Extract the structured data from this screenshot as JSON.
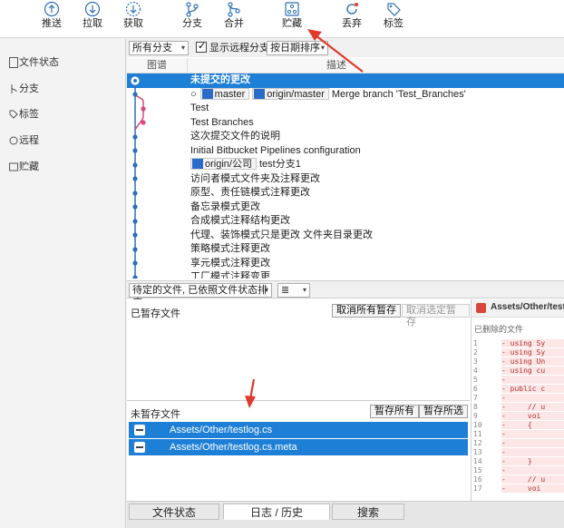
{
  "toolbar": {
    "buttons": [
      {
        "label": "推送",
        "icon": "push-icon"
      },
      {
        "label": "拉取",
        "icon": "pull-icon"
      },
      {
        "label": "获取",
        "icon": "fetch-icon"
      },
      {
        "label": "分支",
        "icon": "branch-icon"
      },
      {
        "label": "合并",
        "icon": "merge-icon"
      },
      {
        "label": "贮藏",
        "icon": "stash-icon"
      },
      {
        "label": "丢弃",
        "icon": "discard-icon"
      },
      {
        "label": "标签",
        "icon": "tag-icon"
      }
    ]
  },
  "sidebar": {
    "items": [
      {
        "label": "文件状态"
      },
      {
        "label": "分支"
      },
      {
        "label": "标签"
      },
      {
        "label": "远程"
      },
      {
        "label": "贮藏"
      }
    ]
  },
  "filters": {
    "branches": "所有分支",
    "show_remote": "显示远程分支",
    "sort": "按日期排序"
  },
  "columns": {
    "graph": "图谱",
    "description": "描述"
  },
  "commits": [
    {
      "msg": "未提交的更改",
      "selected": true
    },
    {
      "msg": "Merge branch 'Test_Branches'",
      "tags": [
        "master",
        "origin/master"
      ]
    },
    {
      "msg": "Test"
    },
    {
      "msg": "Test Branches"
    },
    {
      "msg": "这次提交文件的说明"
    },
    {
      "msg": "Initial Bitbucket Pipelines configuration"
    },
    {
      "msg": "test分支1",
      "tags": [
        "origin/公司"
      ]
    },
    {
      "msg": "访问者模式文件夹及注释更改"
    },
    {
      "msg": "原型、责任链模式注释更改"
    },
    {
      "msg": "备忘录模式更改"
    },
    {
      "msg": "合成模式注释结构更改"
    },
    {
      "msg": "代理、装饰模式只是更改 文件夹目录更改"
    },
    {
      "msg": "策略模式注释更改"
    },
    {
      "msg": "享元模式注释更改"
    },
    {
      "msg": "工厂模式注释变更"
    }
  ],
  "pending": {
    "view_mode": "待定的文件, 已依照文件状态排序",
    "list_icon": "≣"
  },
  "staged": {
    "title": "已暂存文件",
    "unstage_all": "取消所有暂存",
    "unstage_selected": "取消选定暂存"
  },
  "unstaged": {
    "title": "未暂存文件",
    "stage_all": "暂存所有",
    "stage_selected": "暂存所选",
    "files": [
      "Assets/Other/testlog.cs",
      "Assets/Other/testlog.cs.meta"
    ]
  },
  "diff": {
    "file": "Assets/Other/testlog.cs",
    "status": "已删除的文件",
    "lines": [
      {
        "n": "1",
        "code": "- using Sy"
      },
      {
        "n": "2",
        "code": "- using Sy"
      },
      {
        "n": "3",
        "code": "- using Un"
      },
      {
        "n": "4",
        "code": "- using cu"
      },
      {
        "n": "5",
        "code": "-"
      },
      {
        "n": "6",
        "code": "- public c"
      },
      {
        "n": "7",
        "code": "-"
      },
      {
        "n": "8",
        "code": "-     // u"
      },
      {
        "n": "9",
        "code": "-     voi"
      },
      {
        "n": "10",
        "code": "-     {"
      },
      {
        "n": "11",
        "code": "-"
      },
      {
        "n": "12",
        "code": "-"
      },
      {
        "n": "13",
        "code": "-"
      },
      {
        "n": "14",
        "code": "-     }"
      },
      {
        "n": "15",
        "code": "-"
      },
      {
        "n": "16",
        "code": "-     // u"
      },
      {
        "n": "17",
        "code": "-     voi"
      }
    ]
  },
  "tabs": [
    "文件状态",
    "日志 / 历史",
    "搜索"
  ],
  "colors": {
    "accent": "#1e7fd6",
    "graph": "#2d6fb8",
    "graph_alt": "#d94a7a",
    "annotation": "#e03a2e"
  }
}
